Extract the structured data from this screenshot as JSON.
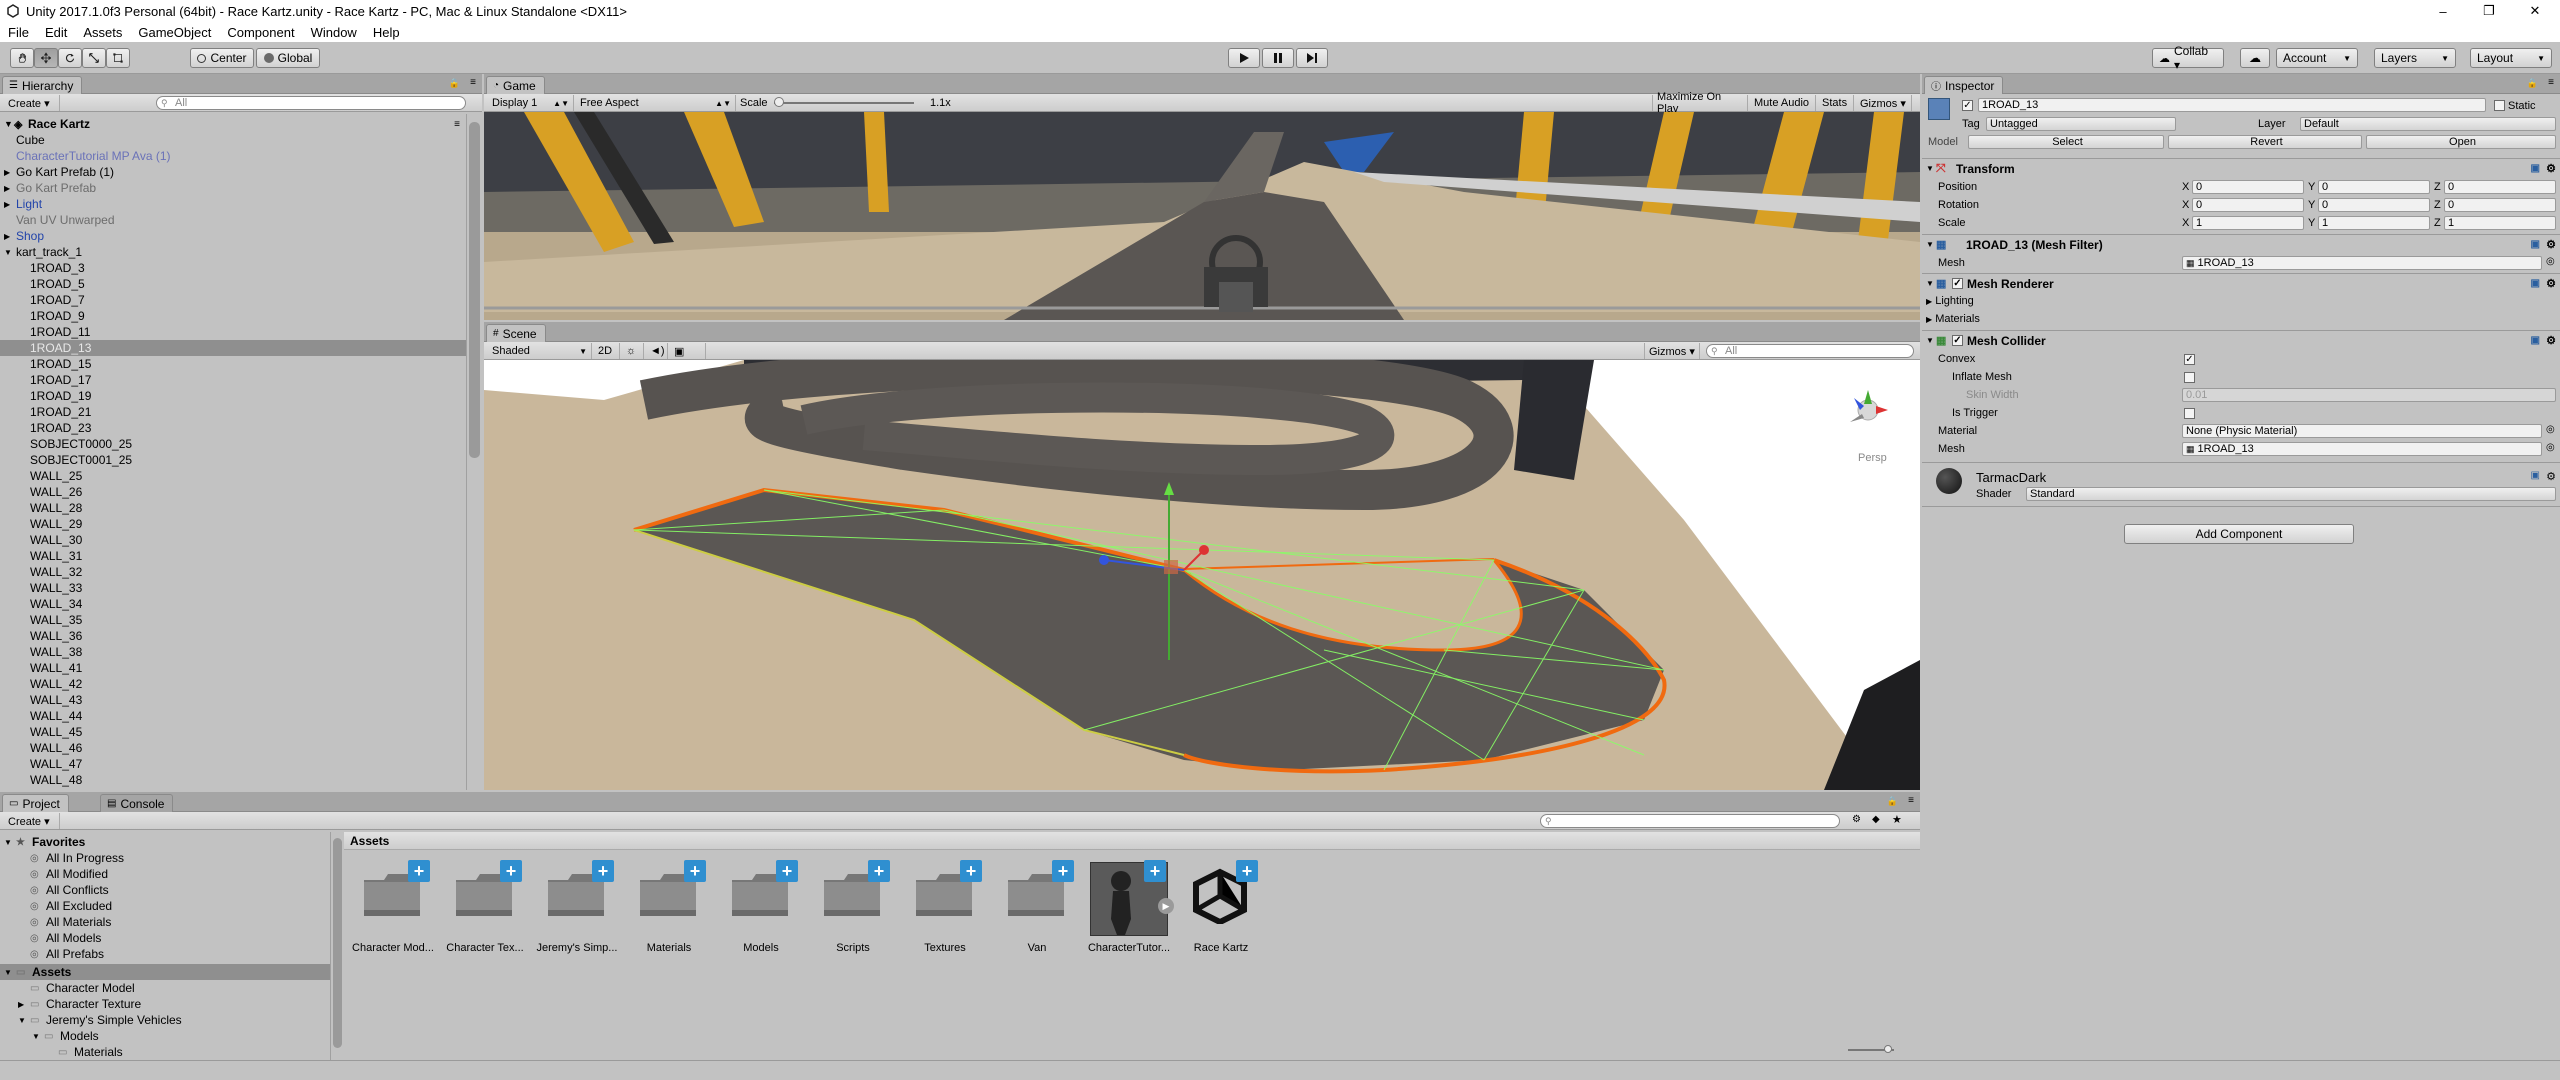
{
  "window": {
    "title": "Unity 2017.1.0f3 Personal (64bit) - Race Kartz.unity - Race Kartz - PC, Mac & Linux Standalone <DX11>",
    "minimize": "–",
    "maximize": "❐",
    "close": "✕"
  },
  "menu": [
    "File",
    "Edit",
    "Assets",
    "GameObject",
    "Component",
    "Window",
    "Help"
  ],
  "toolbar": {
    "center": "Center",
    "global": "Global",
    "collab": "Collab ▾",
    "account": "Account",
    "layers": "Layers",
    "layout": "Layout"
  },
  "hierarchy": {
    "tab": "Hierarchy",
    "create": "Create ▾",
    "search_placeholder": "All",
    "scene": "Race Kartz",
    "rows": [
      {
        "label": "Cube",
        "indent": 1,
        "arrow": "",
        "style": "normal"
      },
      {
        "label": "CharacterTutorial MP Ava (1)",
        "indent": 1,
        "arrow": "",
        "style": "pblue"
      },
      {
        "label": "Go Kart Prefab (1)",
        "indent": 1,
        "arrow": "▶",
        "style": "normal"
      },
      {
        "label": "Go Kart Prefab",
        "indent": 1,
        "arrow": "▶",
        "style": "gray"
      },
      {
        "label": "Light",
        "indent": 1,
        "arrow": "▶",
        "style": "blue"
      },
      {
        "label": "Van UV Unwarped",
        "indent": 1,
        "arrow": "",
        "style": "gray"
      },
      {
        "label": "Shop",
        "indent": 1,
        "arrow": "▶",
        "style": "blue"
      },
      {
        "label": "kart_track_1",
        "indent": 1,
        "arrow": "▼",
        "style": "normal"
      },
      {
        "label": "1ROAD_3",
        "indent": 2,
        "arrow": "",
        "style": "normal"
      },
      {
        "label": "1ROAD_5",
        "indent": 2,
        "arrow": "",
        "style": "normal"
      },
      {
        "label": "1ROAD_7",
        "indent": 2,
        "arrow": "",
        "style": "normal"
      },
      {
        "label": "1ROAD_9",
        "indent": 2,
        "arrow": "",
        "style": "normal"
      },
      {
        "label": "1ROAD_11",
        "indent": 2,
        "arrow": "",
        "style": "normal"
      },
      {
        "label": "1ROAD_13",
        "indent": 2,
        "arrow": "",
        "style": "selected"
      },
      {
        "label": "1ROAD_15",
        "indent": 2,
        "arrow": "",
        "style": "normal"
      },
      {
        "label": "1ROAD_17",
        "indent": 2,
        "arrow": "",
        "style": "normal"
      },
      {
        "label": "1ROAD_19",
        "indent": 2,
        "arrow": "",
        "style": "normal"
      },
      {
        "label": "1ROAD_21",
        "indent": 2,
        "arrow": "",
        "style": "normal"
      },
      {
        "label": "1ROAD_23",
        "indent": 2,
        "arrow": "",
        "style": "normal"
      },
      {
        "label": "SOBJECT0000_25",
        "indent": 2,
        "arrow": "",
        "style": "normal"
      },
      {
        "label": "SOBJECT0001_25",
        "indent": 2,
        "arrow": "",
        "style": "normal"
      },
      {
        "label": "WALL_25",
        "indent": 2,
        "arrow": "",
        "style": "normal"
      },
      {
        "label": "WALL_26",
        "indent": 2,
        "arrow": "",
        "style": "normal"
      },
      {
        "label": "WALL_28",
        "indent": 2,
        "arrow": "",
        "style": "normal"
      },
      {
        "label": "WALL_29",
        "indent": 2,
        "arrow": "",
        "style": "normal"
      },
      {
        "label": "WALL_30",
        "indent": 2,
        "arrow": "",
        "style": "normal"
      },
      {
        "label": "WALL_31",
        "indent": 2,
        "arrow": "",
        "style": "normal"
      },
      {
        "label": "WALL_32",
        "indent": 2,
        "arrow": "",
        "style": "normal"
      },
      {
        "label": "WALL_33",
        "indent": 2,
        "arrow": "",
        "style": "normal"
      },
      {
        "label": "WALL_34",
        "indent": 2,
        "arrow": "",
        "style": "normal"
      },
      {
        "label": "WALL_35",
        "indent": 2,
        "arrow": "",
        "style": "normal"
      },
      {
        "label": "WALL_36",
        "indent": 2,
        "arrow": "",
        "style": "normal"
      },
      {
        "label": "WALL_38",
        "indent": 2,
        "arrow": "",
        "style": "normal"
      },
      {
        "label": "WALL_41",
        "indent": 2,
        "arrow": "",
        "style": "normal"
      },
      {
        "label": "WALL_42",
        "indent": 2,
        "arrow": "",
        "style": "normal"
      },
      {
        "label": "WALL_43",
        "indent": 2,
        "arrow": "",
        "style": "normal"
      },
      {
        "label": "WALL_44",
        "indent": 2,
        "arrow": "",
        "style": "normal"
      },
      {
        "label": "WALL_45",
        "indent": 2,
        "arrow": "",
        "style": "normal"
      },
      {
        "label": "WALL_46",
        "indent": 2,
        "arrow": "",
        "style": "normal"
      },
      {
        "label": "WALL_47",
        "indent": 2,
        "arrow": "",
        "style": "normal"
      },
      {
        "label": "WALL_48",
        "indent": 2,
        "arrow": "",
        "style": "normal"
      }
    ]
  },
  "game": {
    "tab": "Game",
    "display": "Display 1",
    "aspect": "Free Aspect",
    "scale_label": "Scale",
    "scale_value": "1.1x",
    "maximize": "Maximize On Play",
    "mute": "Mute Audio",
    "stats": "Stats",
    "gizmos": "Gizmos ▾"
  },
  "scene": {
    "tab": "Scene",
    "shading": "Shaded",
    "mode_2d": "2D",
    "gizmos": "Gizmos ▾",
    "search_placeholder": "All",
    "persp": "Persp"
  },
  "inspector": {
    "tab": "Inspector",
    "object_name": "1ROAD_13",
    "static": "Static",
    "tag_label": "Tag",
    "tag_value": "Untagged",
    "layer_label": "Layer",
    "layer_value": "Default",
    "model_label": "Model",
    "select": "Select",
    "revert": "Revert",
    "open": "Open",
    "transform": {
      "title": "Transform",
      "rows": [
        {
          "label": "Position",
          "x": "0",
          "y": "0",
          "z": "0"
        },
        {
          "label": "Rotation",
          "x": "0",
          "y": "0",
          "z": "0"
        },
        {
          "label": "Scale",
          "x": "1",
          "y": "1",
          "z": "1"
        }
      ]
    },
    "mesh_filter": {
      "title": "1ROAD_13 (Mesh Filter)",
      "mesh_label": "Mesh",
      "mesh_value": "1ROAD_13"
    },
    "mesh_renderer": {
      "title": "Mesh Renderer",
      "lighting": "Lighting",
      "materials": "Materials"
    },
    "mesh_collider": {
      "title": "Mesh Collider",
      "convex": "Convex",
      "inflate": "Inflate Mesh",
      "skin": "Skin Width",
      "skin_value": "0.01",
      "trigger": "Is Trigger",
      "material_label": "Material",
      "material_value": "None (Physic Material)",
      "mesh_label": "Mesh",
      "mesh_value": "1ROAD_13"
    },
    "material": {
      "name": "TarmacDark",
      "shader_label": "Shader",
      "shader_value": "Standard"
    },
    "add_component": "Add Component"
  },
  "project": {
    "tab": "Project",
    "console_tab": "Console",
    "create": "Create ▾",
    "favorites": {
      "title": "Favorites",
      "items": [
        "All In Progress",
        "All Modified",
        "All Conflicts",
        "All Excluded",
        "All Materials",
        "All Models",
        "All Prefabs"
      ]
    },
    "assets_tree": {
      "title": "Assets",
      "items": [
        {
          "label": "Character Model",
          "indent": 1,
          "arrow": ""
        },
        {
          "label": "Character Texture",
          "indent": 1,
          "arrow": "▶"
        },
        {
          "label": "Jeremy's Simple Vehicles",
          "indent": 1,
          "arrow": "▼"
        },
        {
          "label": "Models",
          "indent": 2,
          "arrow": "▼"
        },
        {
          "label": "Materials",
          "indent": 3,
          "arrow": ""
        }
      ]
    },
    "breadcrumb": "Assets",
    "assets": [
      {
        "label": "Character Mod...",
        "kind": "folder"
      },
      {
        "label": "Character Tex...",
        "kind": "folder"
      },
      {
        "label": "Jeremy's Simp...",
        "kind": "folder"
      },
      {
        "label": "Materials",
        "kind": "folder"
      },
      {
        "label": "Models",
        "kind": "folder"
      },
      {
        "label": "Scripts",
        "kind": "folder"
      },
      {
        "label": "Textures",
        "kind": "folder"
      },
      {
        "label": "Van",
        "kind": "folder"
      },
      {
        "label": "CharacterTutor...",
        "kind": "prefab"
      },
      {
        "label": "Race Kartz",
        "kind": "unity"
      }
    ]
  },
  "colors": {
    "selection": "#8f8f8f",
    "accent_blue": "#2f8fd0",
    "outline_orange": "#f06a10",
    "wire_green": "#88ff66"
  }
}
